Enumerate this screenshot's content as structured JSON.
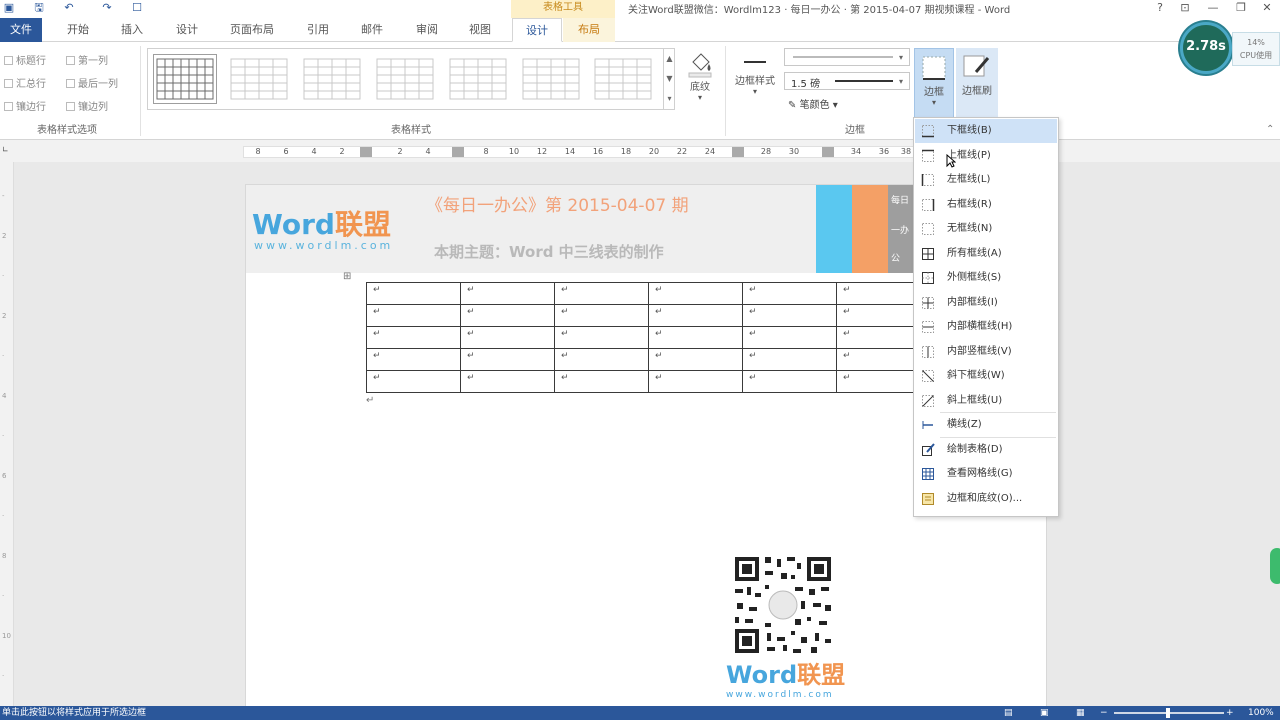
{
  "window": {
    "title": "关注Word联盟微信：Wordlm123 · 每日一办公 · 第 2015-04-07 期视频课程 - Word",
    "contextual_group": "表格工具",
    "controls": {
      "help": "?",
      "ribbon_opts": "⊡",
      "minimize": "—",
      "restore": "❐",
      "close": "✕"
    }
  },
  "tabs": [
    {
      "label": "文件"
    },
    {
      "label": "开始"
    },
    {
      "label": "插入"
    },
    {
      "label": "设计"
    },
    {
      "label": "页面布局"
    },
    {
      "label": "引用"
    },
    {
      "label": "邮件"
    },
    {
      "label": "审阅"
    },
    {
      "label": "视图"
    },
    {
      "label": "设计"
    },
    {
      "label": "布局"
    }
  ],
  "ribbon": {
    "style_options": {
      "label": "表格样式选项",
      "items": [
        "标题行",
        "第一列",
        "汇总行",
        "最后一列",
        "镶边行",
        "镶边列"
      ]
    },
    "table_styles": {
      "label": "表格样式"
    },
    "shading": {
      "label": "底纹"
    },
    "borders_group": {
      "label": "边框",
      "border_styles": "边框样式",
      "weight": "1.5 磅",
      "pen_color": "笔颜色",
      "borders": "边框",
      "border_painter": "边框刷"
    }
  },
  "ruler": {
    "marks": [
      "8",
      "6",
      "4",
      "2",
      "",
      "2",
      "4",
      "",
      "8",
      "10",
      "12",
      "14",
      "16",
      "18",
      "20",
      "22",
      "24",
      "",
      "28",
      "30",
      "",
      "34",
      "36",
      "38"
    ]
  },
  "document": {
    "banner": {
      "logo_word": "Word",
      "logo_cn": "联盟",
      "logo_url": "www.wordlm.com",
      "issue": "《每日一办公》第 2015-04-07 期",
      "topic": "本期主题：Word 中三线表的制作",
      "side_labels": [
        "每日",
        "一办",
        "公"
      ]
    },
    "table_rows": 5,
    "table_cols": 6,
    "cell_mark": "↵",
    "anchor": "⊞",
    "qr_logo_word": "Word",
    "qr_logo_cn": "联盟",
    "qr_url": "www.wordlm.com"
  },
  "borders_menu": {
    "items": [
      {
        "label": "下框线(B)",
        "icon": "bottom-border-icon",
        "highlight": true
      },
      {
        "label": "上框线(P)",
        "icon": "top-border-icon"
      },
      {
        "label": "左框线(L)",
        "icon": "left-border-icon"
      },
      {
        "label": "右框线(R)",
        "icon": "right-border-icon"
      },
      {
        "label": "无框线(N)",
        "icon": "no-border-icon"
      },
      {
        "label": "所有框线(A)",
        "icon": "all-borders-icon"
      },
      {
        "label": "外侧框线(S)",
        "icon": "outside-borders-icon"
      },
      {
        "label": "内部框线(I)",
        "icon": "inside-borders-icon"
      },
      {
        "label": "内部横框线(H)",
        "icon": "inside-horizontal-border-icon"
      },
      {
        "label": "内部竖框线(V)",
        "icon": "inside-vertical-border-icon"
      },
      {
        "label": "斜下框线(W)",
        "icon": "diagonal-down-border-icon"
      },
      {
        "label": "斜上框线(U)",
        "icon": "diagonal-up-border-icon"
      },
      {
        "label": "横线(Z)",
        "icon": "horizontal-line-icon"
      },
      {
        "label": "绘制表格(D)",
        "icon": "draw-table-icon"
      },
      {
        "label": "查看网格线(G)",
        "icon": "view-gridlines-icon"
      },
      {
        "label": "边框和底纹(O)...",
        "icon": "borders-shading-icon"
      }
    ]
  },
  "status_bar": {
    "text": "单击此按钮以将样式应用于所选边框",
    "zoom": "100%"
  },
  "perf_widget": {
    "value": "2.78s",
    "cpu_pct": "14%",
    "cpu_label": "CPU使用"
  },
  "colors": {
    "accent": "#2b579a",
    "context_tab": "#c67a10",
    "menu_highlight": "#cfe2f7"
  }
}
